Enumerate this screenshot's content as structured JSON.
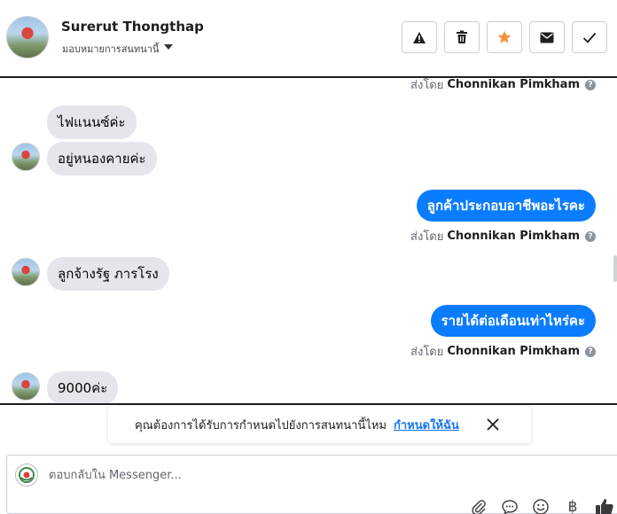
{
  "header": {
    "contact_name": "Surerut Thongthap",
    "assign_label": "มอบหมายการสนทนานี้",
    "tools": [
      {
        "icon": "alert-icon"
      },
      {
        "icon": "trash-icon"
      },
      {
        "icon": "star-icon",
        "color": "#f7923b"
      },
      {
        "icon": "envelope-icon"
      },
      {
        "icon": "check-icon"
      }
    ]
  },
  "sent_by": {
    "prefix": "ส่งโดย",
    "agent": "Chonnikan Pimkham",
    "help": "?"
  },
  "messages": [
    {
      "direction": "in",
      "text": "ไฟแนนซ์ค่ะ"
    },
    {
      "direction": "in",
      "text": "อยู่หนองคายค่ะ"
    },
    {
      "direction": "out",
      "text": "ลูกค้าประกอบอาชีพอะไรคะ"
    },
    {
      "direction": "in",
      "text": "ลูกจ้างรัฐ ภารโรง"
    },
    {
      "direction": "out",
      "text": "รายได้ต่อเดือนเท่าไหร่คะ"
    },
    {
      "direction": "in",
      "text": "9000ค่ะ"
    }
  ],
  "banner": {
    "text": "คุณต้องการได้รับการกำหนดไปยังการสนทนานี้ไหม",
    "link": "กำหนดให้ฉัน"
  },
  "composer": {
    "placeholder": "ตอบกลับใน Messenger...",
    "currency_symbol": "฿"
  },
  "colors": {
    "outgoing_bubble": "#0a7cff",
    "incoming_bubble": "#e4e6eb",
    "link": "#1877f2",
    "star": "#f7923b"
  }
}
